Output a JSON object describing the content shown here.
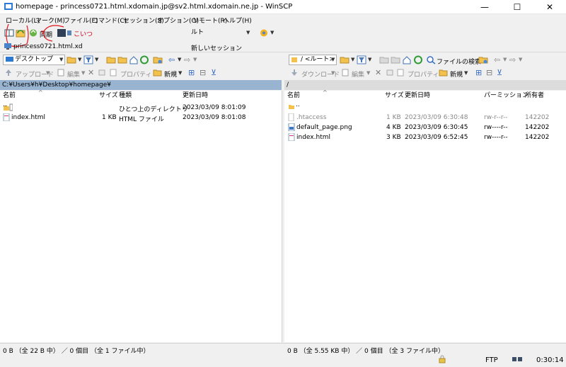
{
  "window": {
    "title": "homepage - princess0721.html.xdomain.jp@sv2.html.xdomain.ne.jp - WinSCP",
    "minimize": "—",
    "maximize": "☐",
    "close": "✕"
  },
  "menu": [
    "ローカル(L)",
    "マーク(M)",
    "ファイル(F)",
    "コマンド(C)",
    "セッション(S)",
    "オプション(O)",
    "リモート(R)",
    "ヘルプ(H)"
  ],
  "toolbar": {
    "sync_label": "同期",
    "session_dropdown": "ルト",
    "annotation": "こいつ"
  },
  "tabs": {
    "session_tab": "princess0721.html.xd",
    "new_session": "新しいセッション"
  },
  "local": {
    "location": "デスクトップ",
    "upload": "アップロード",
    "edit": "編集",
    "properties": "プロパティ",
    "new": "新規",
    "path": "C:¥Users¥h¥Desktop¥homepage¥",
    "columns": {
      "name": "名前",
      "size": "サイズ",
      "type": "種類",
      "modified": "更新日時"
    },
    "rows": [
      {
        "name": "..",
        "size": "",
        "type": "ひとつ上のディレクトリ",
        "modified": "2023/03/09  8:01:09"
      },
      {
        "name": "index.html",
        "size": "1 KB",
        "type": "HTML ファイル",
        "modified": "2023/03/09  8:01:08"
      }
    ],
    "status": "0 B （全 22 B 中） ／ 0 個目 （全 1 ファイル中）"
  },
  "remote": {
    "location": "/ <ルート>",
    "download": "ダウンロード",
    "edit": "編集",
    "properties": "プロパティ",
    "new": "新規",
    "find": "ファイルの検索",
    "path": "/",
    "columns": {
      "name": "名前",
      "size": "サイズ",
      "modified": "更新日時",
      "perm": "パーミッション",
      "owner": "所有者"
    },
    "rows": [
      {
        "name": "..",
        "size": "",
        "modified": "",
        "perm": "",
        "owner": ""
      },
      {
        "name": ".htaccess",
        "size": "1 KB",
        "modified": "2023/03/09 6:30:48",
        "perm": "rw-r--r--",
        "owner": "142202",
        "muted": true
      },
      {
        "name": "default_page.png",
        "size": "4 KB",
        "modified": "2023/03/09 6:30:45",
        "perm": "rw----r--",
        "owner": "142202"
      },
      {
        "name": "index.html",
        "size": "3 KB",
        "modified": "2023/03/09 6:52:45",
        "perm": "rw----r--",
        "owner": "142202"
      }
    ],
    "status": "0 B （全 5.55 KB 中） ／ 0 個目 （全 3 ファイル中）"
  },
  "statusbar": {
    "protocol": "FTP",
    "time": "0:30:14"
  }
}
